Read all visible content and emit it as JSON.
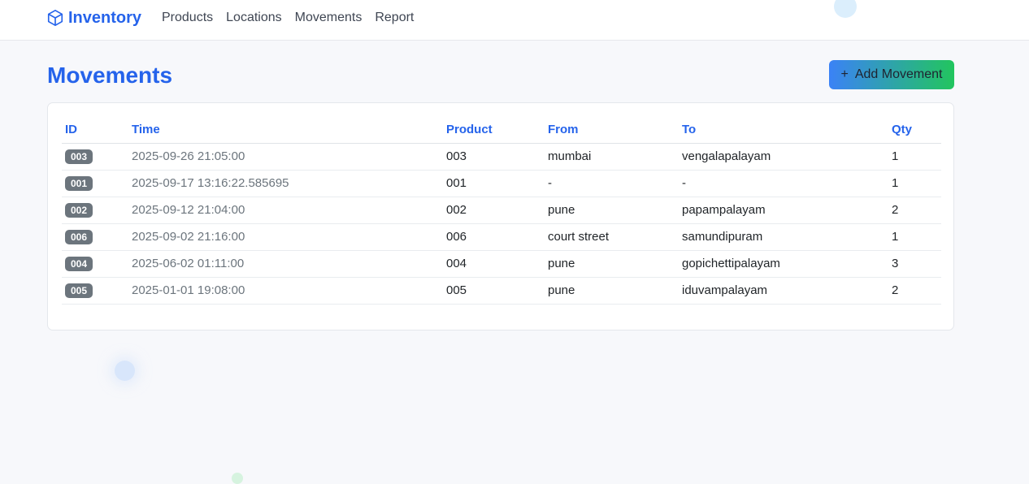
{
  "nav": {
    "brand": "Inventory",
    "links": [
      "Products",
      "Locations",
      "Movements",
      "Report"
    ]
  },
  "page": {
    "title": "Movements",
    "add_button": "Add Movement",
    "add_icon": "+"
  },
  "table": {
    "headers": [
      "ID",
      "Time",
      "Product",
      "From",
      "To",
      "Qty"
    ],
    "rows": [
      {
        "id": "003",
        "time": "2025-09-26 21:05:00",
        "product": "003",
        "from": "mumbai",
        "to": "vengalapalayam",
        "qty": "1"
      },
      {
        "id": "001",
        "time": "2025-09-17 13:16:22.585695",
        "product": "001",
        "from": "-",
        "to": "-",
        "qty": "1"
      },
      {
        "id": "002",
        "time": "2025-09-12 21:04:00",
        "product": "002",
        "from": "pune",
        "to": "papampalayam",
        "qty": "2"
      },
      {
        "id": "006",
        "time": "2025-09-02 21:16:00",
        "product": "006",
        "from": "court street",
        "to": "samundipuram",
        "qty": "1"
      },
      {
        "id": "004",
        "time": "2025-06-02 01:11:00",
        "product": "004",
        "from": "pune",
        "to": "gopichettipalayam",
        "qty": "3"
      },
      {
        "id": "005",
        "time": "2025-01-01 19:08:00",
        "product": "005",
        "from": "pune",
        "to": "iduvampalayam",
        "qty": "2"
      }
    ]
  },
  "colors": {
    "accent": "#2563eb",
    "badge": "#6c757d",
    "gradient_start": "#3b82f6",
    "gradient_end": "#22c55e"
  }
}
